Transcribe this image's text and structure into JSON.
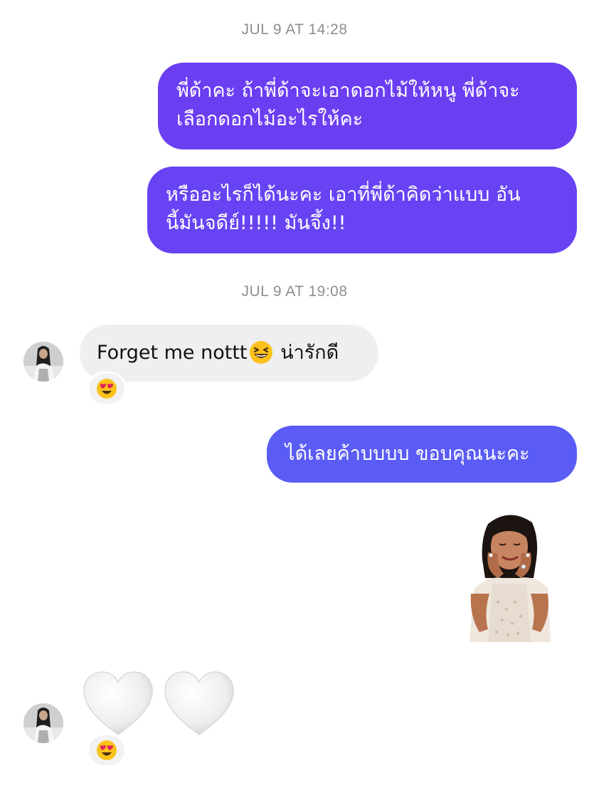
{
  "thread": {
    "timestamp_1": "JUL 9 AT 14:28",
    "timestamp_2": "JUL 9 AT 19:08",
    "msg_out_1": {
      "line1": "พี่ด้าคะ ถ้าพี่ด้าจะเอาดอกไม้ให้หนู พี่ด้าจะ",
      "line2": "เลือกดอกไม้อะไรให้คะ"
    },
    "msg_out_2": {
      "line1": "หรืออะไรก็ได้นะคะ เอาที่พี่ด้าคิดว่าแบบ อัน",
      "line2": "นี้มันจดีย์!!!!! มันจึ้ง!!"
    },
    "msg_in_1": {
      "text_before": "Forget me nottt",
      "emoji": "grinning-squinting-face",
      "text_after": "น่ารักดี",
      "reaction": "heart-eyes-face"
    },
    "msg_out_3": {
      "text": "ได้เลยค้าบบบบ ขอบคุณนะคะ"
    },
    "sticker": {
      "icon": "woman-happy-tears-sticker"
    },
    "msg_in_2": {
      "emoji": [
        "white-heart",
        "white-heart"
      ],
      "reaction": "heart-eyes-face"
    }
  },
  "colors": {
    "bubble_out_top": "#6a3cf2",
    "bubble_out_bottom": "#5a5cf5",
    "bubble_in": "#efeff1",
    "timestamp": "#8e8e93"
  }
}
